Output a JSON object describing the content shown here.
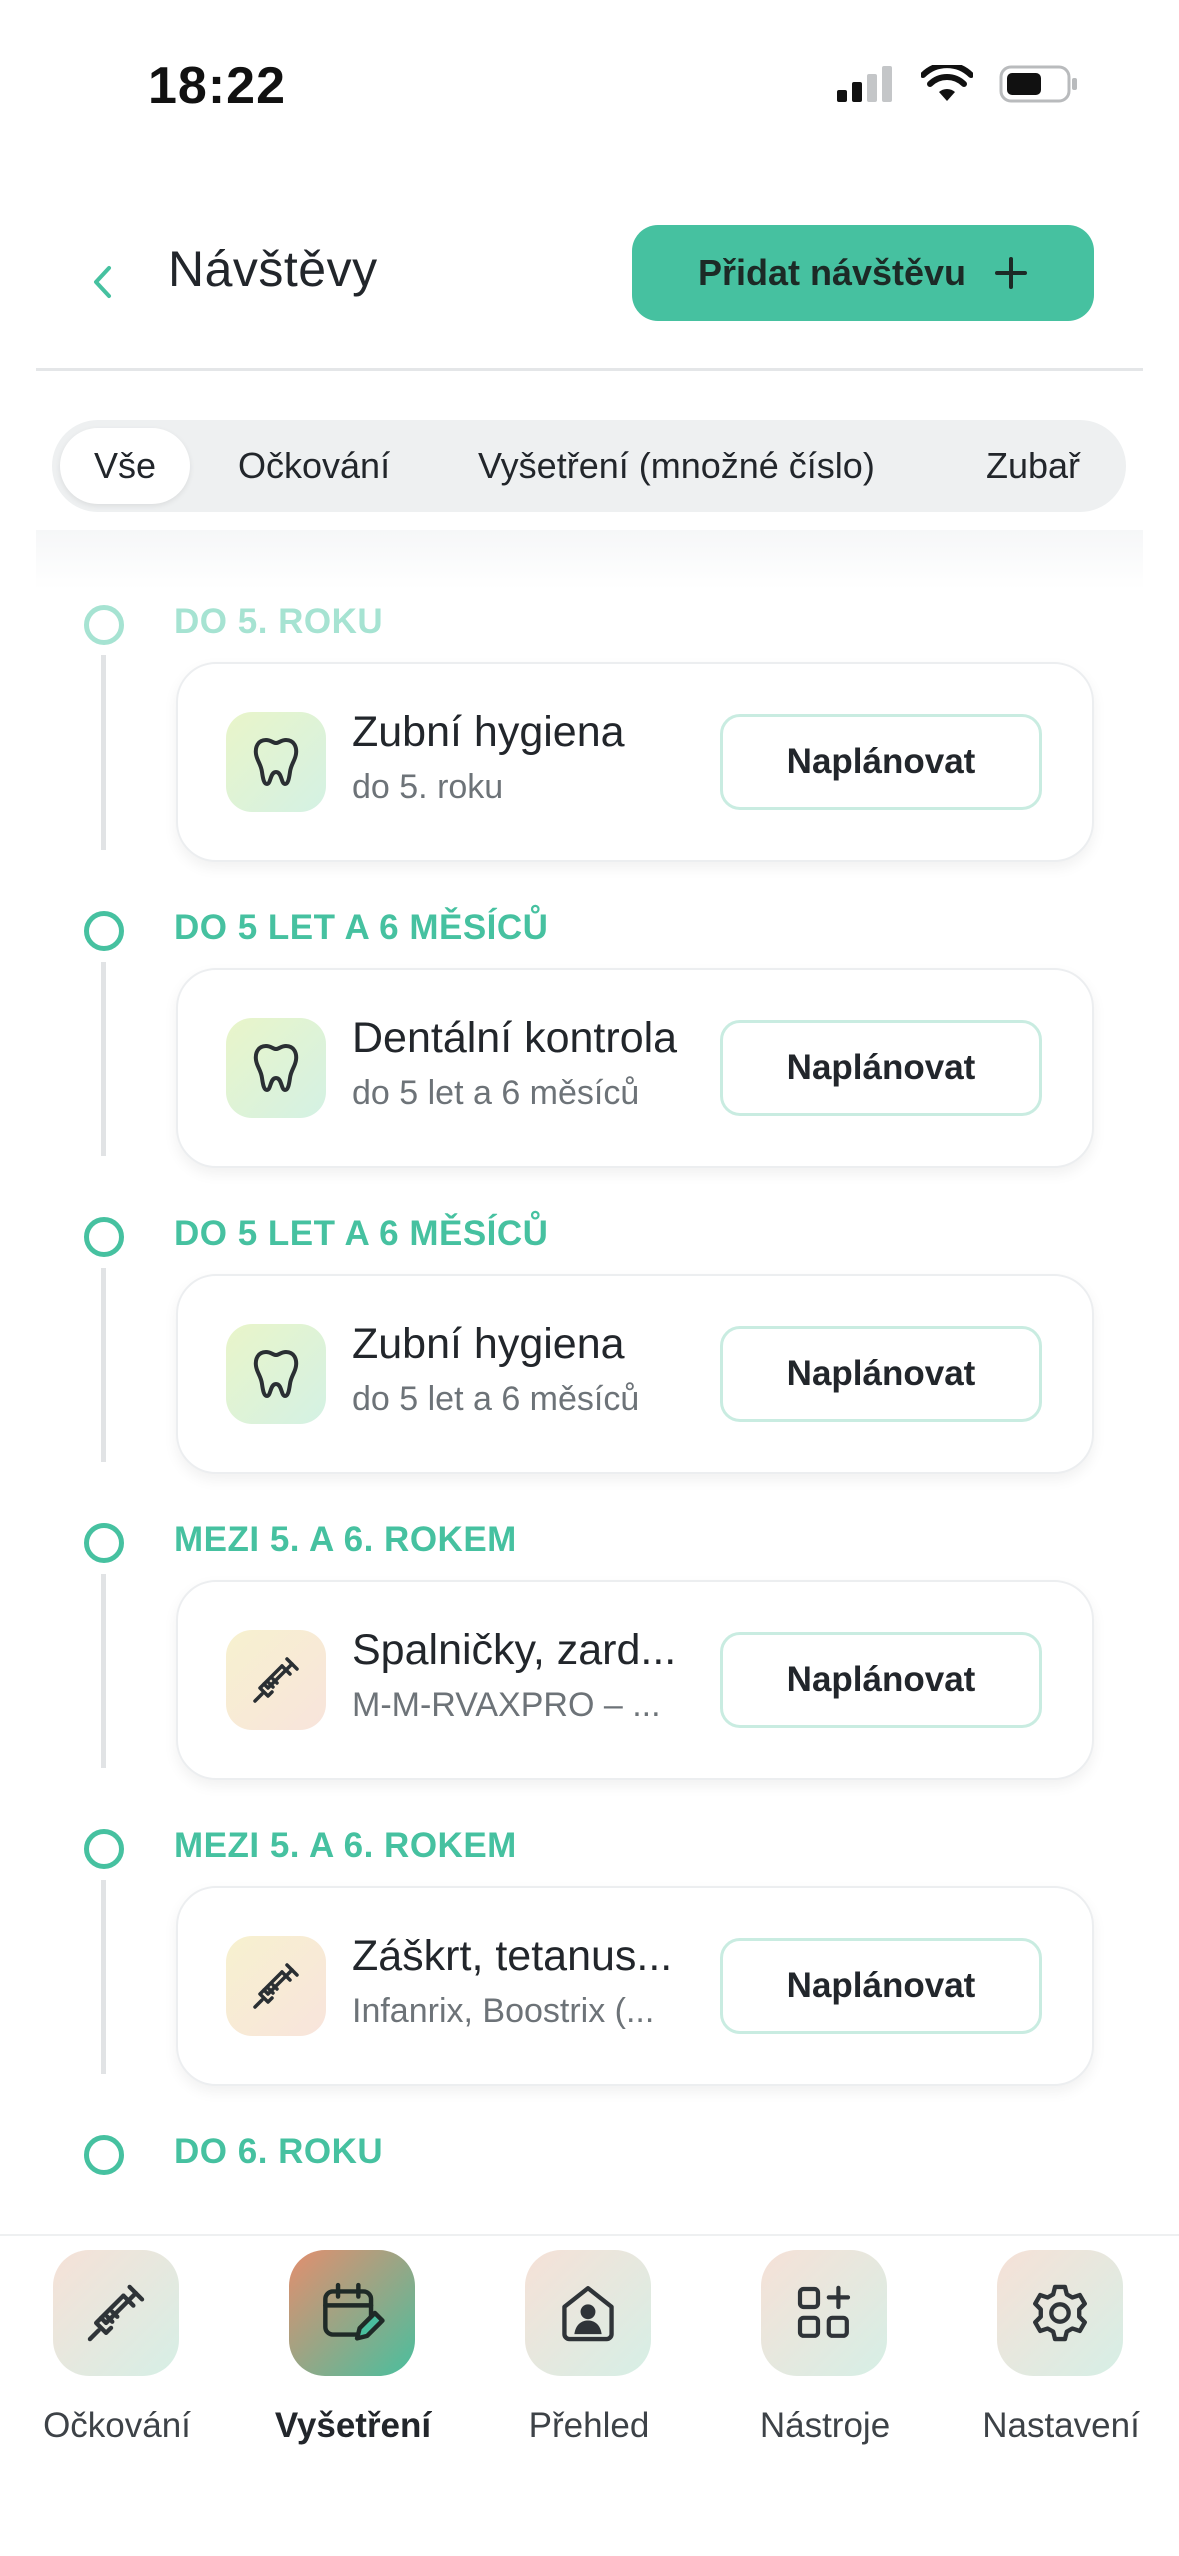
{
  "status_bar": {
    "time": "18:22"
  },
  "header": {
    "title": "Návštěvy",
    "add_button_label": "Přidat návštěvu"
  },
  "filters": {
    "chips": [
      {
        "label": "Vše",
        "active": true
      },
      {
        "label": "Očkování",
        "active": false
      },
      {
        "label": "Vyšetření (množné číslo)",
        "active": false
      },
      {
        "label": "Zubař",
        "active": false
      }
    ]
  },
  "timeline": {
    "groups": [
      {
        "label": "DO 5. ROKU",
        "card": {
          "icon": "tooth-icon",
          "title": "Zubní hygiena",
          "subtitle": "do 5. roku",
          "button": "Naplánovat"
        }
      },
      {
        "label": "DO 5 LET A 6 MĚSÍCŮ",
        "card": {
          "icon": "tooth-icon",
          "title": "Dentální kontrola",
          "subtitle": "do 5 let a 6 měsíců",
          "button": "Naplánovat"
        }
      },
      {
        "label": "DO 5 LET A 6 MĚSÍCŮ",
        "card": {
          "icon": "tooth-icon",
          "title": "Zubní hygiena",
          "subtitle": "do 5 let a 6 měsíců",
          "button": "Naplánovat"
        }
      },
      {
        "label": "MEZI 5. A 6. ROKEM",
        "card": {
          "icon": "syringe-icon",
          "title": "Spalničky, zard...",
          "subtitle": "M-M-RVAXPRO – ...",
          "button": "Naplánovat"
        }
      },
      {
        "label": "MEZI 5. A 6. ROKEM",
        "card": {
          "icon": "syringe-icon",
          "title": "Záškrt, tetanus...",
          "subtitle": "Infanrix, Boostrix (...",
          "button": "Naplánovat"
        }
      },
      {
        "label": "DO 6. ROKU"
      }
    ]
  },
  "tabbar": {
    "tabs": [
      {
        "label": "Očkování",
        "icon": "syringe-icon",
        "active": false
      },
      {
        "label": "Vyšetření",
        "icon": "calendar-edit-icon",
        "active": true
      },
      {
        "label": "Přehled",
        "icon": "profile-house-icon",
        "active": false
      },
      {
        "label": "Nástroje",
        "icon": "grid-plus-icon",
        "active": false
      },
      {
        "label": "Nastavení",
        "icon": "gear-icon",
        "active": false
      }
    ]
  },
  "colors": {
    "accent": "#46c1a0",
    "accent_faded": "#a6e3d2",
    "text": "#22262b",
    "subtext": "#6d7378"
  }
}
